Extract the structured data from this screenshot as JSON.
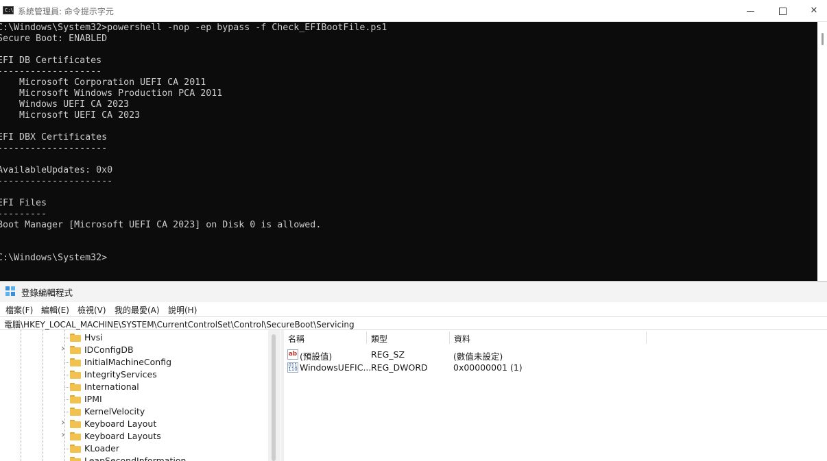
{
  "console": {
    "title": "系統管理員: 命令提示字元",
    "icon_text": "C:\\",
    "lines": [
      "C:\\Windows\\System32>powershell -nop -ep bypass -f Check_EFIBootFile.ps1",
      "Secure Boot: ENABLED",
      "",
      "EFI DB Certificates",
      "-------------------",
      "    Microsoft Corporation UEFI CA 2011",
      "    Microsoft Windows Production PCA 2011",
      "    Windows UEFI CA 2023",
      "    Microsoft UEFI CA 2023",
      "",
      "EFI DBX Certificates",
      "--------------------",
      "",
      "AvailableUpdates: 0x0",
      "---------------------",
      "",
      "EFI Files",
      "---------",
      "Boot Manager [Microsoft UEFI CA 2023] on Disk 0 is allowed.",
      "",
      "",
      "C:\\Windows\\System32>"
    ]
  },
  "regedit": {
    "title": "登錄編輯程式",
    "menu": [
      "檔案(F)",
      "編輯(E)",
      "檢視(V)",
      "我的最愛(A)",
      "說明(H)"
    ],
    "address": "電腦\\HKEY_LOCAL_MACHINE\\SYSTEM\\CurrentControlSet\\Control\\SecureBoot\\Servicing",
    "tree_items": [
      {
        "label": "Hvsi",
        "expandable": false
      },
      {
        "label": "IDConfigDB",
        "expandable": true
      },
      {
        "label": "InitialMachineConfig",
        "expandable": false
      },
      {
        "label": "IntegrityServices",
        "expandable": false
      },
      {
        "label": "International",
        "expandable": false
      },
      {
        "label": "IPMI",
        "expandable": false
      },
      {
        "label": "KernelVelocity",
        "expandable": false
      },
      {
        "label": "Keyboard Layout",
        "expandable": true
      },
      {
        "label": "Keyboard Layouts",
        "expandable": true
      },
      {
        "label": "KLoader",
        "expandable": false
      },
      {
        "label": "LeapSecondInformation",
        "expandable": false
      }
    ],
    "columns": [
      "名稱",
      "類型",
      "資料"
    ],
    "values": [
      {
        "icon": "string-value-icon",
        "icon_text": "ab",
        "name": "(預設值)",
        "type": "REG_SZ",
        "data": "(數值未設定)"
      },
      {
        "icon": "binary-value-icon",
        "icon_text": "011\n110",
        "name": "WindowsUEFIC...",
        "type": "REG_DWORD",
        "data": "0x00000001 (1)"
      }
    ]
  },
  "window_controls": {
    "minimize": "—",
    "maximize": "☐",
    "close": "✕"
  }
}
